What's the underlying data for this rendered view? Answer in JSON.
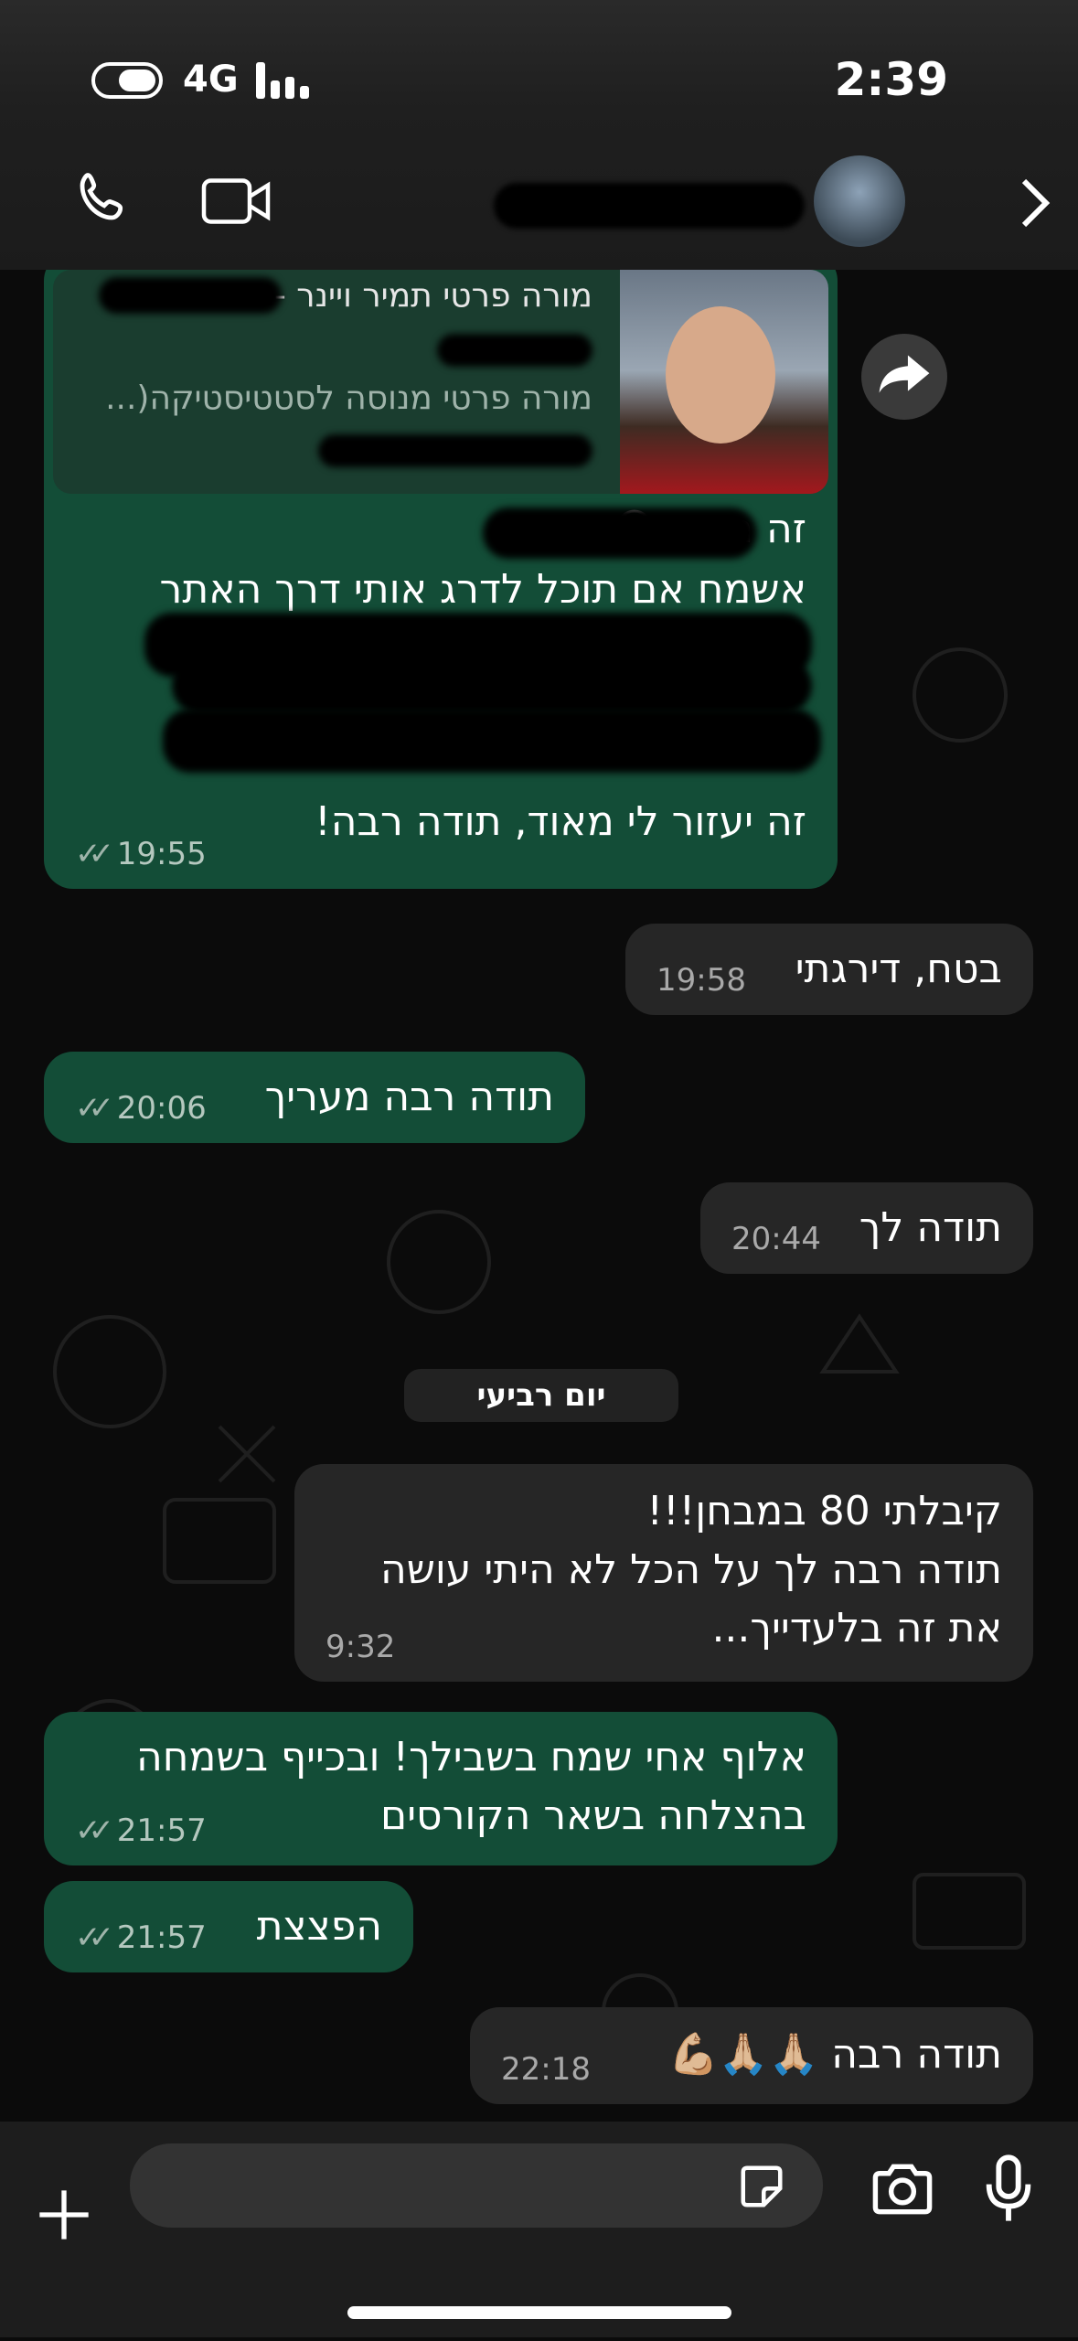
{
  "status_bar": {
    "network": "4G",
    "time": "2:39"
  },
  "header": {
    "contact_name": ""
  },
  "messages": [
    {
      "id": "m1",
      "direction": "out",
      "link_preview": {
        "title": "מורה פרטי תמיר ויינר -",
        "description": "מורה פרטי מנוסה לסטטיסטיקה(..."
      },
      "lines": [
        "זה תמיר 😃",
        "אשמח אם תוכל לדרג אותי דרך האתר"
      ],
      "last_line": "זה יעזור לי מאוד, תודה רבה!",
      "time": "19:55"
    },
    {
      "id": "m2",
      "direction": "in",
      "text": "בטח, דירגתי",
      "time": "19:58"
    },
    {
      "id": "m3",
      "direction": "out",
      "text": "תודה רבה מעריך",
      "time": "20:06"
    },
    {
      "id": "m4",
      "direction": "in",
      "text": "תודה לך",
      "time": "20:44"
    },
    {
      "id": "m5",
      "direction": "in",
      "text": "קיבלתי 80 במבחן!!!\nתודה רבה לך על הכל לא היתי עושה\nאת זה בלעדייך...",
      "time": "9:32"
    },
    {
      "id": "m6",
      "direction": "out",
      "text": "אלוף אחי שמח בשבילך! ובכייף בשמחה\nבהצלחה בשאר הקורסים",
      "time": "21:57"
    },
    {
      "id": "m7",
      "direction": "out",
      "text": "הפצצת",
      "time": "21:57"
    },
    {
      "id": "m8",
      "direction": "in",
      "text": "תודה רבה 🙏🏼🙏🏼💪🏼",
      "time": "22:18"
    }
  ],
  "date_separator": "יום רביעי",
  "composer": {
    "placeholder": ""
  },
  "icons": {
    "call": "phone-icon",
    "video": "video-camera-icon",
    "back": "chevron-right-icon",
    "forward": "forward-arrow-icon",
    "attach": "plus-icon",
    "sticker": "sticker-icon",
    "camera": "camera-icon",
    "mic": "microphone-icon"
  },
  "colors": {
    "outgoing": "#134d37",
    "incoming": "#262626",
    "background": "#0b0b0b"
  }
}
